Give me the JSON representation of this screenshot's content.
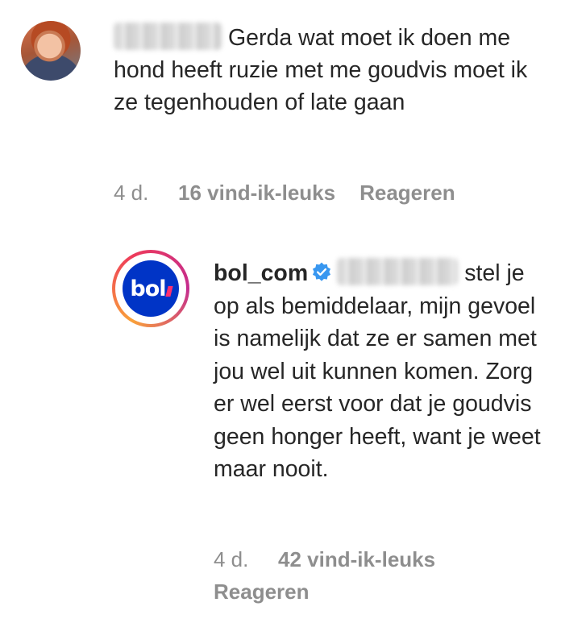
{
  "comment": {
    "text": "Gerda wat moet ik doen me hond heeft ruzie met me goudvis moet ik ze tegenhouden of late gaan",
    "time": "4 d.",
    "likes": "16 vind-ik-leuks",
    "reply_label": "Reageren"
  },
  "reply": {
    "username": "bol_com",
    "avatar_logo": "bol",
    "verified_icon": "verified-badge-icon",
    "text": "stel je op als bemiddelaar, mijn gevoel is namelijk dat ze er samen met jou wel uit kunnen komen. Zorg er wel eerst voor dat je goudvis geen honger heeft, want je weet maar nooit.",
    "time": "4 d.",
    "likes": "42 vind-ik-leuks",
    "reply_label": "Reageren"
  },
  "colors": {
    "text": "#262626",
    "meta": "#8e8e8e",
    "verified": "#3897f0",
    "brand_blue": "#0034c6",
    "brand_pink": "#ff2f6e"
  }
}
